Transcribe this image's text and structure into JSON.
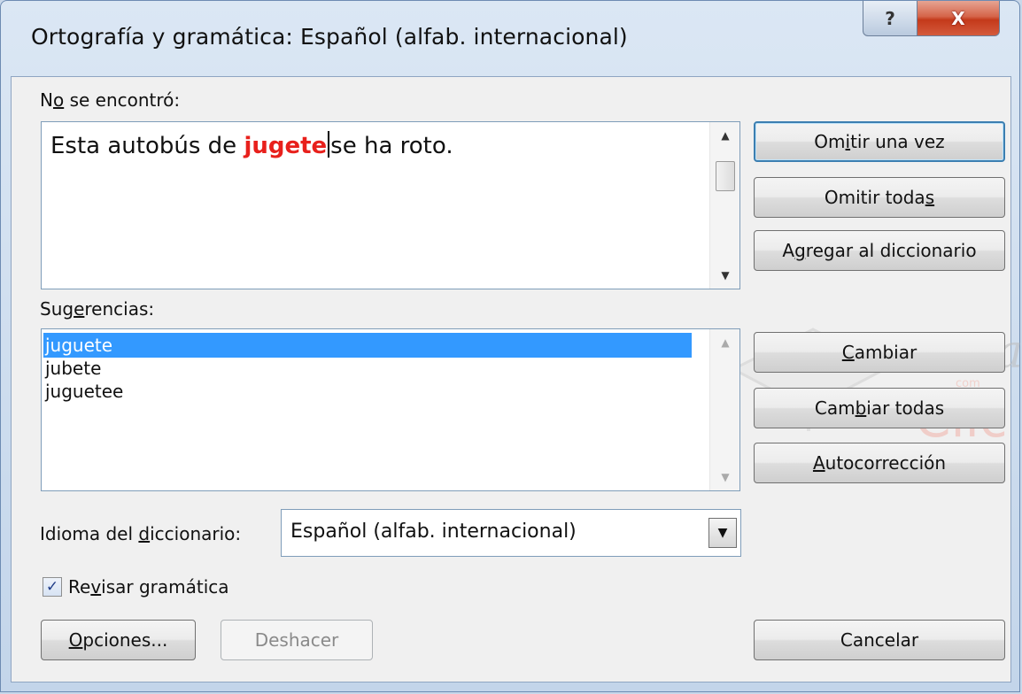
{
  "window": {
    "title": "Ortografía y gramática: Español (alfab. internacional)",
    "help_glyph": "?",
    "close_glyph": "X"
  },
  "not_found": {
    "label_pre": "N",
    "label_accel": "o",
    "label_post": " se encontró:",
    "text_before": "Esta autobús de ",
    "error_word": "jugete",
    "text_after": "se ha roto."
  },
  "suggestions": {
    "label_pre": "Sug",
    "label_accel": "e",
    "label_post": "rencias:",
    "items": [
      "juguete",
      "jubete",
      "juguetee"
    ],
    "selected_index": 0
  },
  "dictionary": {
    "label_pre": "Idioma del ",
    "label_accel": "d",
    "label_post": "iccionario:",
    "value": "Español (alfab. internacional)"
  },
  "grammar_check": {
    "label_pre": "Re",
    "label_accel": "v",
    "label_post": "isar gramática",
    "checked": true
  },
  "buttons": {
    "ignore_once": {
      "pre": "Om",
      "accel": "i",
      "post": "tir una vez"
    },
    "ignore_all": {
      "pre": "Omitir toda",
      "accel": "s",
      "post": ""
    },
    "add_dict": {
      "pre": "A",
      "accel": "g",
      "post": "regar al diccionario"
    },
    "change": {
      "pre": "",
      "accel": "C",
      "post": "ambiar"
    },
    "change_all": {
      "pre": "Cam",
      "accel": "b",
      "post": "iar todas"
    },
    "autocorrect": {
      "pre": "",
      "accel": "A",
      "post": "utocorrección"
    },
    "options": {
      "pre": "",
      "accel": "O",
      "post": "pciones..."
    },
    "undo": {
      "label": "Deshacer"
    },
    "cancel": {
      "label": "Cancelar"
    }
  },
  "icons": {
    "scroll_up": "▲",
    "scroll_down": "▼",
    "dropdown": "▼",
    "check": "✓"
  },
  "watermark": {
    "line1": "aula",
    "line2": "Clic",
    "line3": "com"
  },
  "colors": {
    "error_word": "#e8201c",
    "selection": "#3399ff",
    "close_button": "#c4391a"
  }
}
